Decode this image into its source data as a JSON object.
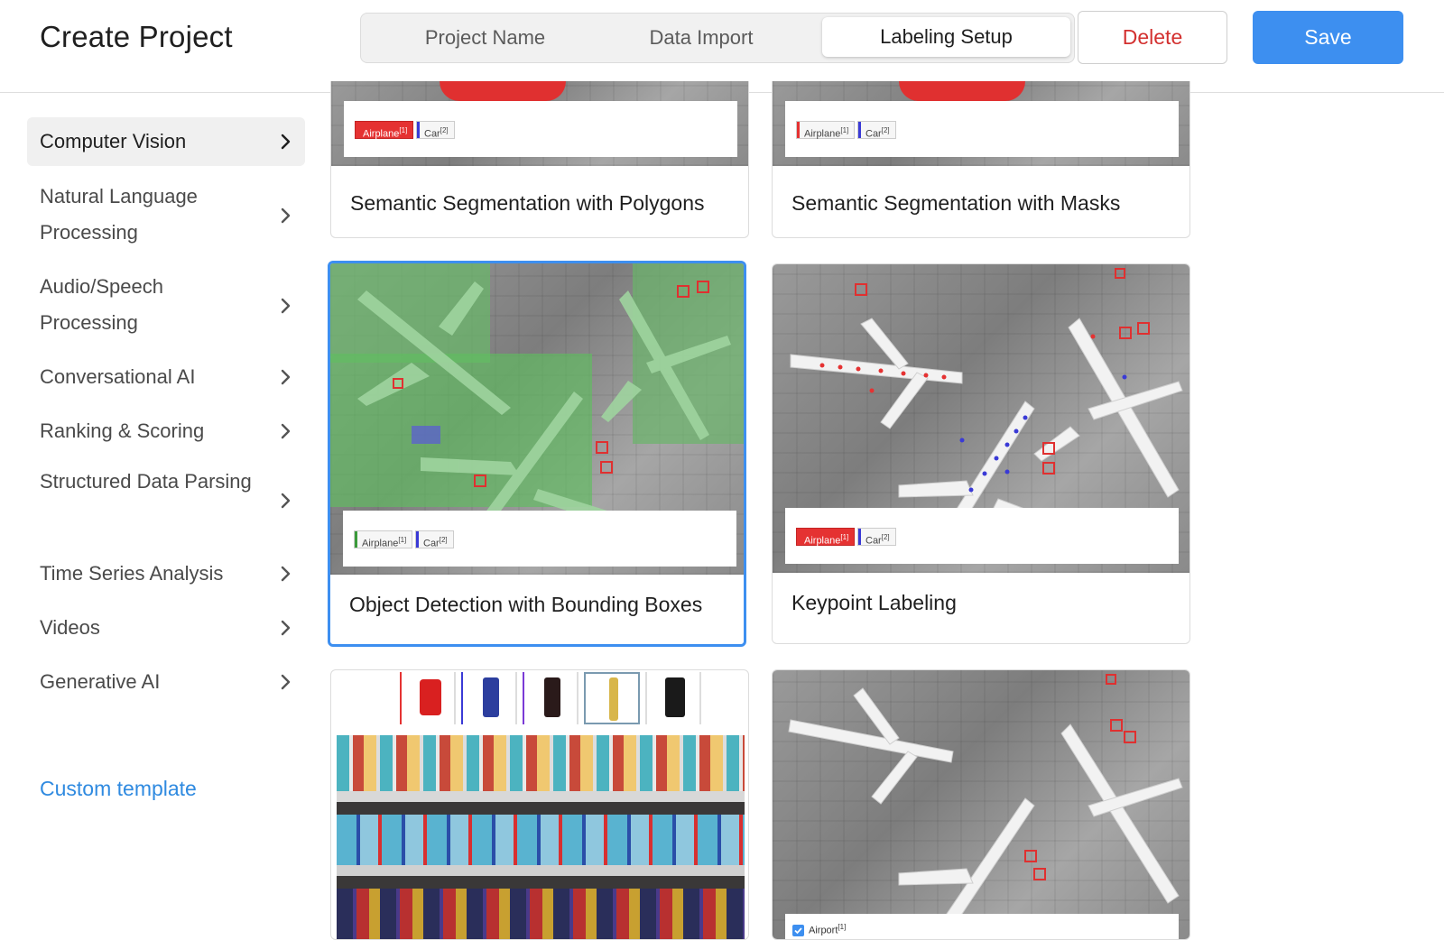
{
  "header": {
    "title": "Create Project",
    "tabs": [
      "Project Name",
      "Data Import",
      "Labeling Setup"
    ],
    "active_tab": "Labeling Setup",
    "delete_label": "Delete",
    "save_label": "Save"
  },
  "sidebar": {
    "items": [
      {
        "label": "Computer Vision",
        "active": true
      },
      {
        "label": "Natural Language Processing",
        "active": false
      },
      {
        "label": "Audio/Speech Processing",
        "active": false
      },
      {
        "label": "Conversational AI",
        "active": false
      },
      {
        "label": "Ranking & Scoring",
        "active": false
      },
      {
        "label": "Structured Data Parsing",
        "active": false
      },
      {
        "label": "Time Series Analysis",
        "active": false
      },
      {
        "label": "Videos",
        "active": false
      },
      {
        "label": "Generative AI",
        "active": false
      }
    ],
    "custom_template_label": "Custom template"
  },
  "templates": [
    {
      "title": "Semantic Segmentation with Polygons",
      "tags": [
        {
          "text": "Airplane",
          "key": "[1]"
        },
        {
          "text": "Car",
          "key": "[2]"
        }
      ]
    },
    {
      "title": "Semantic Segmentation with Masks",
      "tags": [
        {
          "text": "Airplane",
          "key": "[1]"
        },
        {
          "text": "Car",
          "key": "[2]"
        }
      ]
    },
    {
      "title": "Object Detection with Bounding Boxes",
      "selected": true,
      "tags": [
        {
          "text": "Airplane",
          "key": "[1]"
        },
        {
          "text": "Car",
          "key": "[2]"
        }
      ]
    },
    {
      "title": "Keypoint Labeling",
      "tags": [
        {
          "text": "Airplane",
          "key": "[1]"
        },
        {
          "text": "Car",
          "key": "[2]"
        }
      ]
    },
    {
      "title": "",
      "tags": []
    },
    {
      "title": "",
      "tags": [
        {
          "text": "Airport",
          "key": "[1]"
        }
      ]
    }
  ],
  "colors": {
    "accent": "#3d8ff0",
    "delete": "#d3302f",
    "link": "#2f8ae0",
    "tag_red": "#e53232",
    "tag_blue": "#3a3ad6",
    "tag_green": "#3a9a3a",
    "bbox_green": "#5fbf5f"
  },
  "icons": {
    "chevron": "chevron-right-icon",
    "checkbox": "checkbox-checked-icon"
  }
}
